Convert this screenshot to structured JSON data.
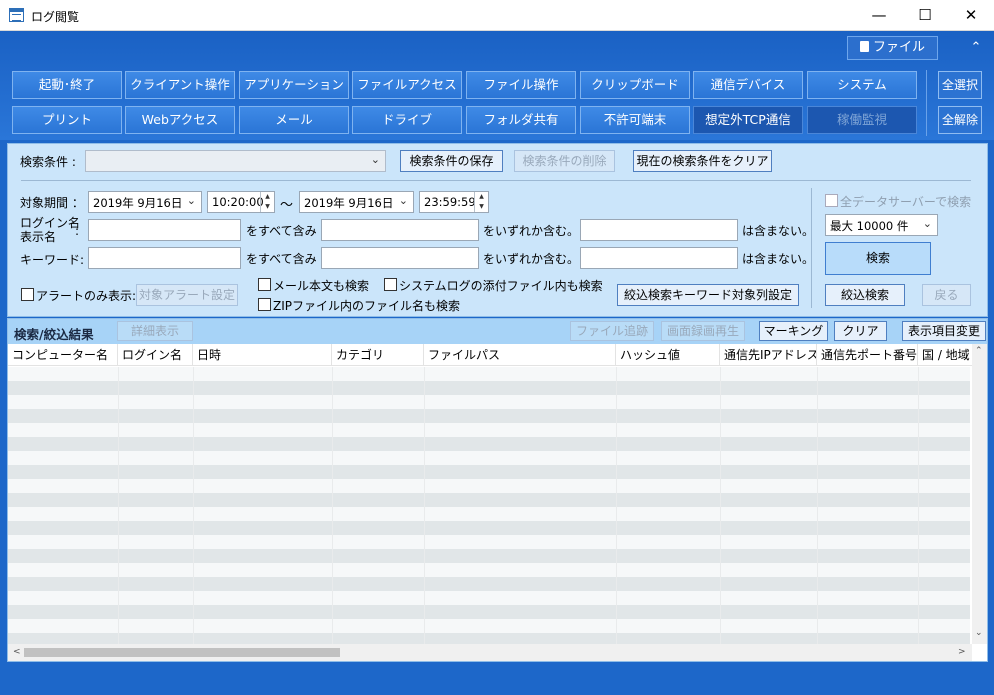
{
  "window": {
    "title": "ログ閲覧",
    "minimize": "—",
    "maximize": "☐",
    "close": "✕"
  },
  "ribbon": {
    "file_button": "ファイル",
    "collapse": "⌃",
    "row1": [
      "起動･終了",
      "クライアント操作",
      "アプリケーション",
      "ファイルアクセス",
      "ファイル操作",
      "クリップボード",
      "通信デバイス",
      "システム"
    ],
    "row2": [
      "プリント",
      "Webアクセス",
      "メール",
      "ドライブ",
      "フォルダ共有",
      "不許可端末",
      "想定外TCP通信",
      "稼働監視"
    ],
    "select_all": "全選択",
    "deselect_all": "全解除"
  },
  "search": {
    "condition_label": "検索条件 :",
    "condition_value": "",
    "save": "検索条件の保存",
    "delete": "検索条件の削除",
    "clear_current": "現在の検索条件をクリア",
    "period_label": "対象期間 ：",
    "start_date": "2019年 9月16日",
    "start_time": "10:20:00",
    "tilde": "～",
    "end_date": "2019年 9月16日",
    "end_time": "23:59:59",
    "login_label1": "ログイン名",
    "login_label2": "表示名",
    "colon": ":",
    "keyword_label": "キーワード:",
    "all_contains": "をすべて含み",
    "any_contains": "をいずれか含む。",
    "not_contains": "は含まない。",
    "alert_only": "アラートのみ表示:",
    "alert_setting": "対象アラート設定",
    "mail_body": "メール本文も検索",
    "syslog_attach": "システムログの添付ファイル内も検索",
    "zip_names": "ZIPファイル内のファイル名も検索",
    "narrow_keyword_setting": "絞込検索キーワード対象列設定",
    "all_servers": "全データサーバーで検索",
    "max_count": "最大 10000 件",
    "search_button": "検索",
    "narrow_search": "絞込検索",
    "back": "戻る"
  },
  "results": {
    "title": "検索/絞込結果",
    "detail": "詳細表示",
    "file_trace": "ファイル追跡",
    "screen_playback": "画面録画再生",
    "marking": "マーキング",
    "clear": "クリア",
    "column_settings": "表示項目変更",
    "columns": [
      "コンピューター名",
      "ログイン名",
      "日時",
      "カテゴリ",
      "ファイルパス",
      "ハッシュ値",
      "通信先IPアドレス",
      "通信先ポート番号",
      "国 / 地域"
    ]
  },
  "scroll": {
    "up": "⌃",
    "down": "⌄",
    "left": "<",
    "right": ">"
  },
  "icons": {
    "app": "log-viewer-icon",
    "file": "file-icon",
    "dropdown": "chevron-down-icon"
  },
  "colors": {
    "ribbon": "#1d67c9",
    "ribbon_button": "#3581e0",
    "panel": "#cbe5fa",
    "results_header": "#a7d3f7"
  }
}
